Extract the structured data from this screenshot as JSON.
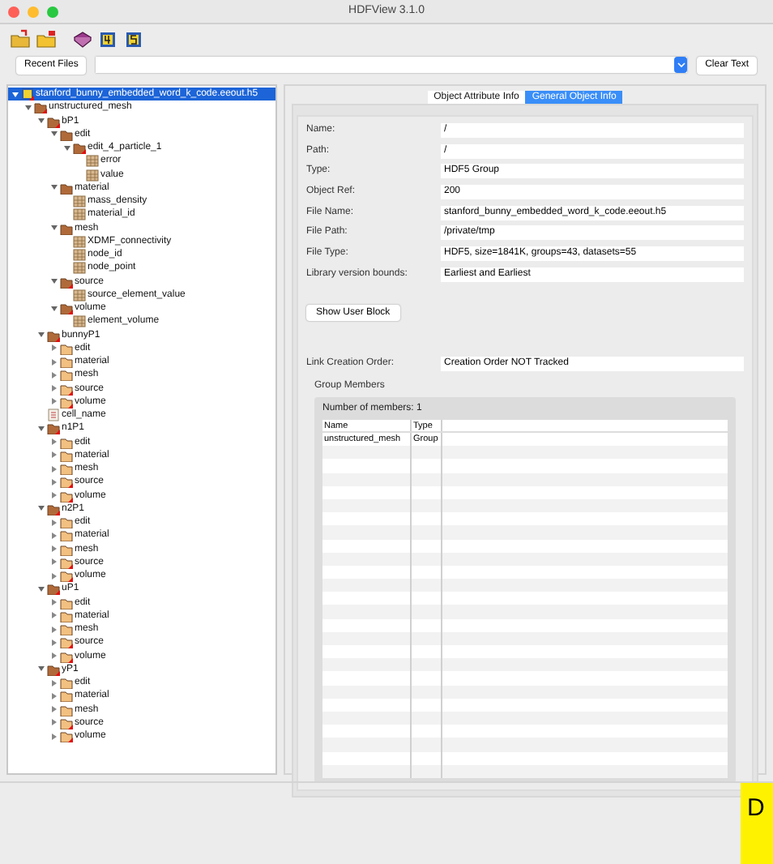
{
  "window": {
    "title": "HDFView 3.1.0"
  },
  "toolbar": {
    "buttons": [
      {
        "kind": "open"
      },
      {
        "kind": "close"
      },
      {
        "kind": "help"
      },
      {
        "kind": "h4"
      },
      {
        "kind": "h5"
      }
    ]
  },
  "file_bar": {
    "recent_button": "Recent Files",
    "clear_button": "Clear Text"
  },
  "tree": [
    {
      "label": "stanford_bunny_embedded_word_k_code.eeout.h5",
      "kind": "file",
      "expanded": true,
      "selected": true,
      "attr": true,
      "children": [
        {
          "label": "unstructured_mesh",
          "kind": "group",
          "expanded": true,
          "selected": false,
          "attr": true,
          "children": [
            {
              "label": "bP1",
              "kind": "group",
              "expanded": true,
              "selected": false,
              "attr": true,
              "children": [
                {
                  "label": "edit",
                  "kind": "group",
                  "expanded": true,
                  "selected": false,
                  "attr": false,
                  "children": [
                    {
                      "label": "edit_4_particle_1",
                      "kind": "group",
                      "expanded": true,
                      "selected": false,
                      "attr": true,
                      "children": [
                        {
                          "label": "error",
                          "kind": "dataset",
                          "selected": false,
                          "attr": false
                        },
                        {
                          "label": "value",
                          "kind": "dataset",
                          "selected": false,
                          "attr": false
                        }
                      ]
                    }
                  ]
                },
                {
                  "label": "material",
                  "kind": "group",
                  "expanded": true,
                  "selected": false,
                  "attr": false,
                  "children": [
                    {
                      "label": "mass_density",
                      "kind": "dataset",
                      "selected": false,
                      "attr": false
                    },
                    {
                      "label": "material_id",
                      "kind": "dataset",
                      "selected": false,
                      "attr": false
                    }
                  ]
                },
                {
                  "label": "mesh",
                  "kind": "group",
                  "expanded": true,
                  "selected": false,
                  "attr": false,
                  "children": [
                    {
                      "label": "XDMF_connectivity",
                      "kind": "dataset",
                      "selected": false,
                      "attr": false
                    },
                    {
                      "label": "node_id",
                      "kind": "dataset",
                      "selected": false,
                      "attr": false
                    },
                    {
                      "label": "node_point",
                      "kind": "dataset",
                      "selected": false,
                      "attr": false
                    }
                  ]
                },
                {
                  "label": "source",
                  "kind": "group",
                  "expanded": true,
                  "selected": false,
                  "attr": true,
                  "children": [
                    {
                      "label": "source_element_value",
                      "kind": "dataset",
                      "selected": false,
                      "attr": false
                    }
                  ]
                },
                {
                  "label": "volume",
                  "kind": "group",
                  "expanded": true,
                  "selected": false,
                  "attr": true,
                  "children": [
                    {
                      "label": "element_volume",
                      "kind": "dataset",
                      "selected": false,
                      "attr": false
                    }
                  ]
                }
              ]
            },
            {
              "label": "bunnyP1",
              "kind": "group",
              "expanded": true,
              "selected": false,
              "attr": true,
              "children": [
                {
                  "label": "edit",
                  "kind": "group",
                  "expanded": false,
                  "selected": false,
                  "attr": false
                },
                {
                  "label": "material",
                  "kind": "group",
                  "expanded": false,
                  "selected": false,
                  "attr": false
                },
                {
                  "label": "mesh",
                  "kind": "group",
                  "expanded": false,
                  "selected": false,
                  "attr": false
                },
                {
                  "label": "source",
                  "kind": "group",
                  "expanded": false,
                  "selected": false,
                  "attr": true
                },
                {
                  "label": "volume",
                  "kind": "group",
                  "expanded": false,
                  "selected": false,
                  "attr": true
                }
              ]
            },
            {
              "label": "cell_name",
              "kind": "text",
              "selected": false,
              "attr": false
            },
            {
              "label": "n1P1",
              "kind": "group",
              "expanded": true,
              "selected": false,
              "attr": true,
              "children": [
                {
                  "label": "edit",
                  "kind": "group",
                  "expanded": false,
                  "selected": false,
                  "attr": false
                },
                {
                  "label": "material",
                  "kind": "group",
                  "expanded": false,
                  "selected": false,
                  "attr": false
                },
                {
                  "label": "mesh",
                  "kind": "group",
                  "expanded": false,
                  "selected": false,
                  "attr": false
                },
                {
                  "label": "source",
                  "kind": "group",
                  "expanded": false,
                  "selected": false,
                  "attr": true
                },
                {
                  "label": "volume",
                  "kind": "group",
                  "expanded": false,
                  "selected": false,
                  "attr": true
                }
              ]
            },
            {
              "label": "n2P1",
              "kind": "group",
              "expanded": true,
              "selected": false,
              "attr": true,
              "children": [
                {
                  "label": "edit",
                  "kind": "group",
                  "expanded": false,
                  "selected": false,
                  "attr": false
                },
                {
                  "label": "material",
                  "kind": "group",
                  "expanded": false,
                  "selected": false,
                  "attr": false
                },
                {
                  "label": "mesh",
                  "kind": "group",
                  "expanded": false,
                  "selected": false,
                  "attr": false
                },
                {
                  "label": "source",
                  "kind": "group",
                  "expanded": false,
                  "selected": false,
                  "attr": true
                },
                {
                  "label": "volume",
                  "kind": "group",
                  "expanded": false,
                  "selected": false,
                  "attr": true
                }
              ]
            },
            {
              "label": "uP1",
              "kind": "group",
              "expanded": true,
              "selected": false,
              "attr": true,
              "children": [
                {
                  "label": "edit",
                  "kind": "group",
                  "expanded": false,
                  "selected": false,
                  "attr": false
                },
                {
                  "label": "material",
                  "kind": "group",
                  "expanded": false,
                  "selected": false,
                  "attr": false
                },
                {
                  "label": "mesh",
                  "kind": "group",
                  "expanded": false,
                  "selected": false,
                  "attr": false
                },
                {
                  "label": "source",
                  "kind": "group",
                  "expanded": false,
                  "selected": false,
                  "attr": true
                },
                {
                  "label": "volume",
                  "kind": "group",
                  "expanded": false,
                  "selected": false,
                  "attr": true
                }
              ]
            },
            {
              "label": "yP1",
              "kind": "group",
              "expanded": true,
              "selected": false,
              "attr": true,
              "children": [
                {
                  "label": "edit",
                  "kind": "group",
                  "expanded": false,
                  "selected": false,
                  "attr": false
                },
                {
                  "label": "material",
                  "kind": "group",
                  "expanded": false,
                  "selected": false,
                  "attr": false
                },
                {
                  "label": "mesh",
                  "kind": "group",
                  "expanded": false,
                  "selected": false,
                  "attr": false
                },
                {
                  "label": "source",
                  "kind": "group",
                  "expanded": false,
                  "selected": false,
                  "attr": true
                },
                {
                  "label": "volume",
                  "kind": "group",
                  "expanded": false,
                  "selected": false,
                  "attr": true
                }
              ]
            }
          ]
        }
      ]
    }
  ],
  "tabs": [
    {
      "label": "Object Attribute Info",
      "selected": false
    },
    {
      "label": "General Object Info",
      "selected": true
    }
  ],
  "info_fields": [
    {
      "label": "Name:",
      "value": "/"
    },
    {
      "label": "Path:",
      "value": "/"
    },
    {
      "label": "Type:",
      "value": "HDF5 Group"
    },
    {
      "label": "Object Ref:",
      "value": "200"
    },
    {
      "label": "File Name:",
      "value": "stanford_bunny_embedded_word_k_code.eeout.h5"
    },
    {
      "label": "File Path:",
      "value": "/private/tmp"
    },
    {
      "label": "File Type:",
      "value": "HDF5,  size=1841K,  groups=43,  datasets=55"
    },
    {
      "label": "Library version bounds:",
      "value": "Earliest and Earliest"
    }
  ],
  "user_block_button": "Show User Block",
  "link_creation": {
    "label": "Link Creation Order:",
    "value": "Creation Order NOT Tracked"
  },
  "group_members": {
    "title": "Group Members",
    "count": "Number of members: 1",
    "columns": [
      "Name",
      "Type"
    ],
    "rows": [
      [
        "unstructured_mesh",
        "Group"
      ]
    ]
  },
  "status_badge": "D"
}
